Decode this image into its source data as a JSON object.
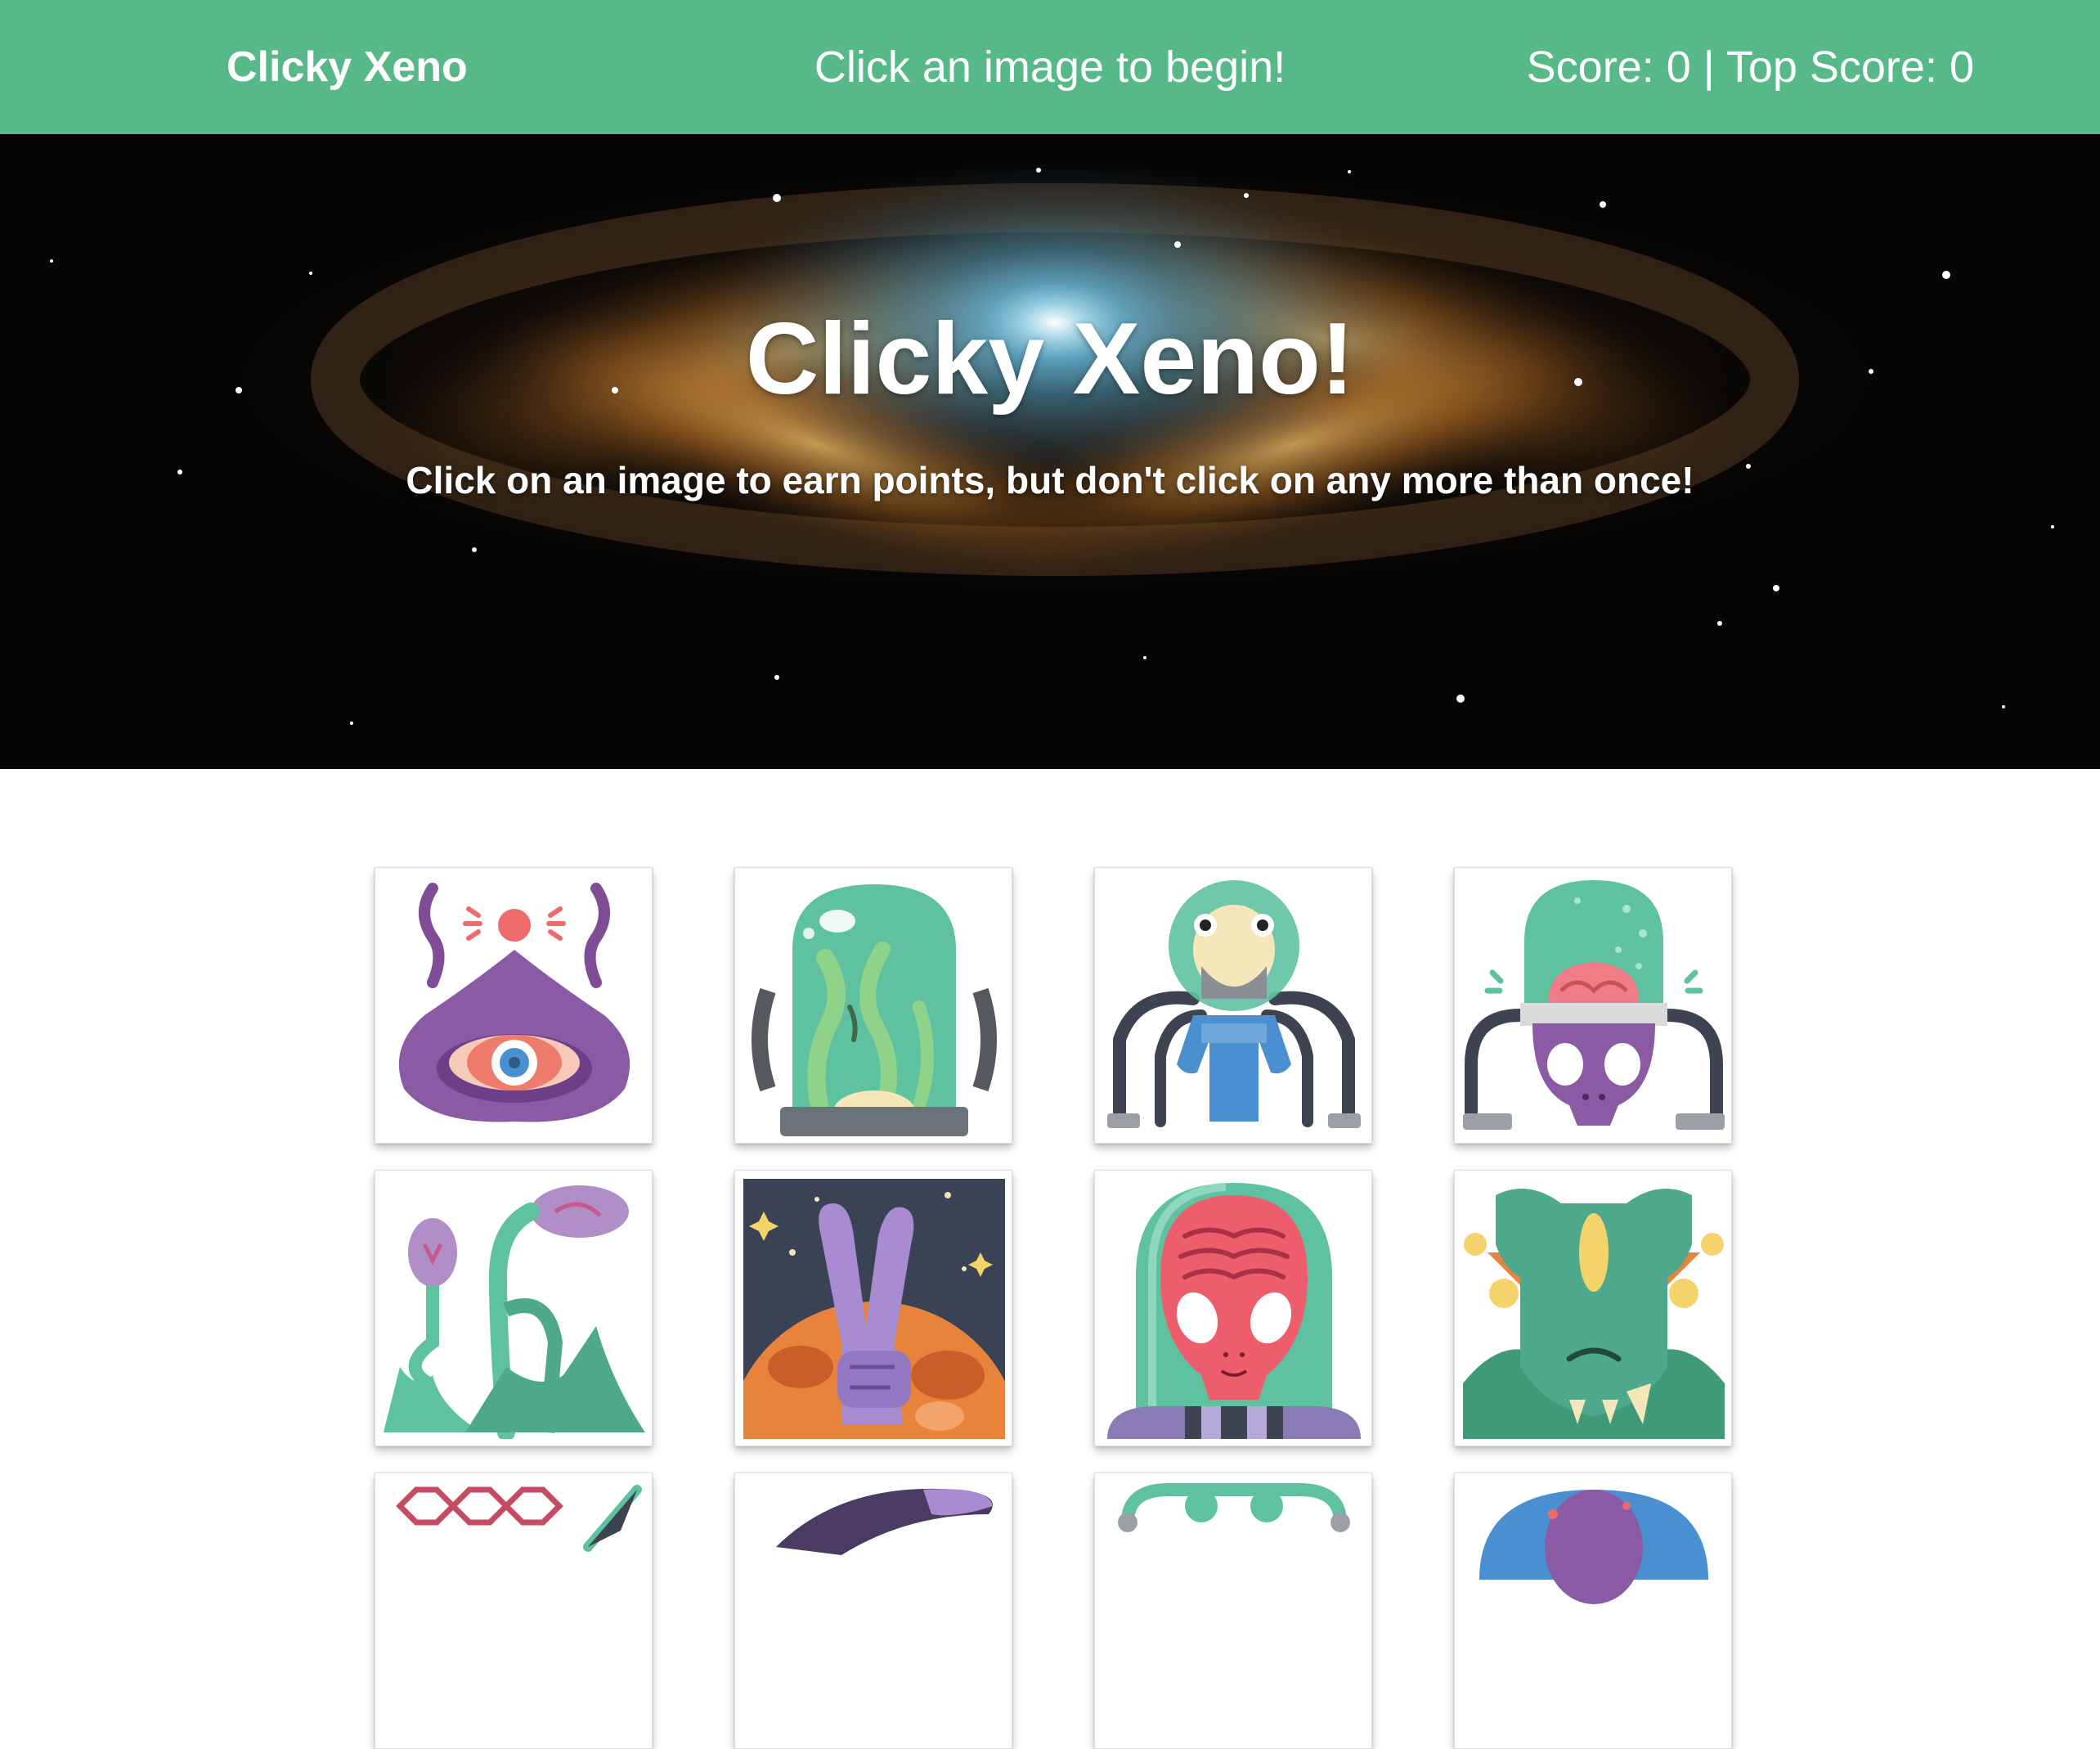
{
  "navbar": {
    "brand": "Clicky Xeno",
    "message": "Click an image to begin!",
    "score_text": "Score: 0 | Top Score: 0"
  },
  "score": {
    "current": 0,
    "top": 0
  },
  "hero": {
    "title": "Clicky Xeno!",
    "subtitle": "Click on an image to earn points, but don't click on any more than once!",
    "background_icon": "nebula-space-image"
  },
  "colors": {
    "navbar": "#57b987",
    "text": "#ffffff",
    "card_border": "#dedede"
  },
  "cards": [
    {
      "icon": "purple-cyclops-alien-icon"
    },
    {
      "icon": "alien-in-jar-icon"
    },
    {
      "icon": "octopus-astronaut-alien-icon"
    },
    {
      "icon": "brain-dome-skull-alien-icon"
    },
    {
      "icon": "alien-plants-icon"
    },
    {
      "icon": "alien-hand-planet-icon"
    },
    {
      "icon": "red-alien-helmet-icon"
    },
    {
      "icon": "green-horned-alien-icon"
    },
    {
      "icon": "hexagon-alien-icon"
    },
    {
      "icon": "dark-tentacle-alien-icon"
    },
    {
      "icon": "green-goggles-alien-icon"
    },
    {
      "icon": "blue-dome-alien-icon"
    }
  ]
}
